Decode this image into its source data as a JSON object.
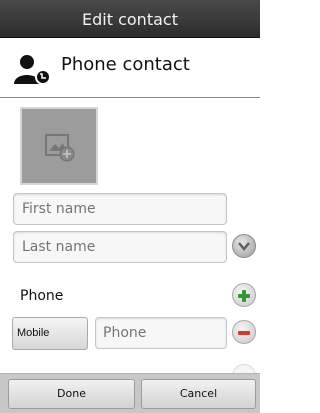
{
  "title": "Edit contact",
  "account": {
    "title": "Phone contact",
    "icon": "contact-phone-icon"
  },
  "photo": {
    "icon": "add-photo-icon"
  },
  "name": {
    "first_placeholder": "First name",
    "last_placeholder": "Last name",
    "expand_icon": "chevron-down-icon"
  },
  "phone": {
    "section_label": "Phone",
    "type_label": "Mobile",
    "placeholder": "Phone",
    "add_icon": "plus-icon",
    "remove_icon": "minus-icon"
  },
  "actions": {
    "done_label": "Done",
    "cancel_label": "Cancel"
  },
  "colors": {
    "add": "#2f9a2f",
    "remove": "#d23a3a",
    "titlebar": "#333333"
  }
}
